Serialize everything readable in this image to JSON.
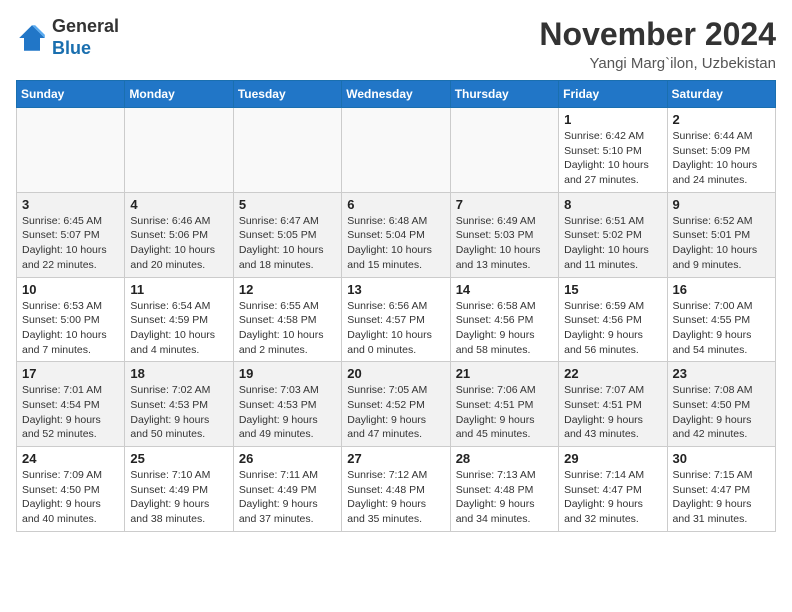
{
  "header": {
    "logo_line1": "General",
    "logo_line2": "Blue",
    "month": "November 2024",
    "location": "Yangi Marg`ilon, Uzbekistan"
  },
  "weekdays": [
    "Sunday",
    "Monday",
    "Tuesday",
    "Wednesday",
    "Thursday",
    "Friday",
    "Saturday"
  ],
  "weeks": [
    [
      {
        "day": "",
        "info": ""
      },
      {
        "day": "",
        "info": ""
      },
      {
        "day": "",
        "info": ""
      },
      {
        "day": "",
        "info": ""
      },
      {
        "day": "",
        "info": ""
      },
      {
        "day": "1",
        "info": "Sunrise: 6:42 AM\nSunset: 5:10 PM\nDaylight: 10 hours and 27 minutes."
      },
      {
        "day": "2",
        "info": "Sunrise: 6:44 AM\nSunset: 5:09 PM\nDaylight: 10 hours and 24 minutes."
      }
    ],
    [
      {
        "day": "3",
        "info": "Sunrise: 6:45 AM\nSunset: 5:07 PM\nDaylight: 10 hours and 22 minutes."
      },
      {
        "day": "4",
        "info": "Sunrise: 6:46 AM\nSunset: 5:06 PM\nDaylight: 10 hours and 20 minutes."
      },
      {
        "day": "5",
        "info": "Sunrise: 6:47 AM\nSunset: 5:05 PM\nDaylight: 10 hours and 18 minutes."
      },
      {
        "day": "6",
        "info": "Sunrise: 6:48 AM\nSunset: 5:04 PM\nDaylight: 10 hours and 15 minutes."
      },
      {
        "day": "7",
        "info": "Sunrise: 6:49 AM\nSunset: 5:03 PM\nDaylight: 10 hours and 13 minutes."
      },
      {
        "day": "8",
        "info": "Sunrise: 6:51 AM\nSunset: 5:02 PM\nDaylight: 10 hours and 11 minutes."
      },
      {
        "day": "9",
        "info": "Sunrise: 6:52 AM\nSunset: 5:01 PM\nDaylight: 10 hours and 9 minutes."
      }
    ],
    [
      {
        "day": "10",
        "info": "Sunrise: 6:53 AM\nSunset: 5:00 PM\nDaylight: 10 hours and 7 minutes."
      },
      {
        "day": "11",
        "info": "Sunrise: 6:54 AM\nSunset: 4:59 PM\nDaylight: 10 hours and 4 minutes."
      },
      {
        "day": "12",
        "info": "Sunrise: 6:55 AM\nSunset: 4:58 PM\nDaylight: 10 hours and 2 minutes."
      },
      {
        "day": "13",
        "info": "Sunrise: 6:56 AM\nSunset: 4:57 PM\nDaylight: 10 hours and 0 minutes."
      },
      {
        "day": "14",
        "info": "Sunrise: 6:58 AM\nSunset: 4:56 PM\nDaylight: 9 hours and 58 minutes."
      },
      {
        "day": "15",
        "info": "Sunrise: 6:59 AM\nSunset: 4:56 PM\nDaylight: 9 hours and 56 minutes."
      },
      {
        "day": "16",
        "info": "Sunrise: 7:00 AM\nSunset: 4:55 PM\nDaylight: 9 hours and 54 minutes."
      }
    ],
    [
      {
        "day": "17",
        "info": "Sunrise: 7:01 AM\nSunset: 4:54 PM\nDaylight: 9 hours and 52 minutes."
      },
      {
        "day": "18",
        "info": "Sunrise: 7:02 AM\nSunset: 4:53 PM\nDaylight: 9 hours and 50 minutes."
      },
      {
        "day": "19",
        "info": "Sunrise: 7:03 AM\nSunset: 4:53 PM\nDaylight: 9 hours and 49 minutes."
      },
      {
        "day": "20",
        "info": "Sunrise: 7:05 AM\nSunset: 4:52 PM\nDaylight: 9 hours and 47 minutes."
      },
      {
        "day": "21",
        "info": "Sunrise: 7:06 AM\nSunset: 4:51 PM\nDaylight: 9 hours and 45 minutes."
      },
      {
        "day": "22",
        "info": "Sunrise: 7:07 AM\nSunset: 4:51 PM\nDaylight: 9 hours and 43 minutes."
      },
      {
        "day": "23",
        "info": "Sunrise: 7:08 AM\nSunset: 4:50 PM\nDaylight: 9 hours and 42 minutes."
      }
    ],
    [
      {
        "day": "24",
        "info": "Sunrise: 7:09 AM\nSunset: 4:50 PM\nDaylight: 9 hours and 40 minutes."
      },
      {
        "day": "25",
        "info": "Sunrise: 7:10 AM\nSunset: 4:49 PM\nDaylight: 9 hours and 38 minutes."
      },
      {
        "day": "26",
        "info": "Sunrise: 7:11 AM\nSunset: 4:49 PM\nDaylight: 9 hours and 37 minutes."
      },
      {
        "day": "27",
        "info": "Sunrise: 7:12 AM\nSunset: 4:48 PM\nDaylight: 9 hours and 35 minutes."
      },
      {
        "day": "28",
        "info": "Sunrise: 7:13 AM\nSunset: 4:48 PM\nDaylight: 9 hours and 34 minutes."
      },
      {
        "day": "29",
        "info": "Sunrise: 7:14 AM\nSunset: 4:47 PM\nDaylight: 9 hours and 32 minutes."
      },
      {
        "day": "30",
        "info": "Sunrise: 7:15 AM\nSunset: 4:47 PM\nDaylight: 9 hours and 31 minutes."
      }
    ]
  ]
}
